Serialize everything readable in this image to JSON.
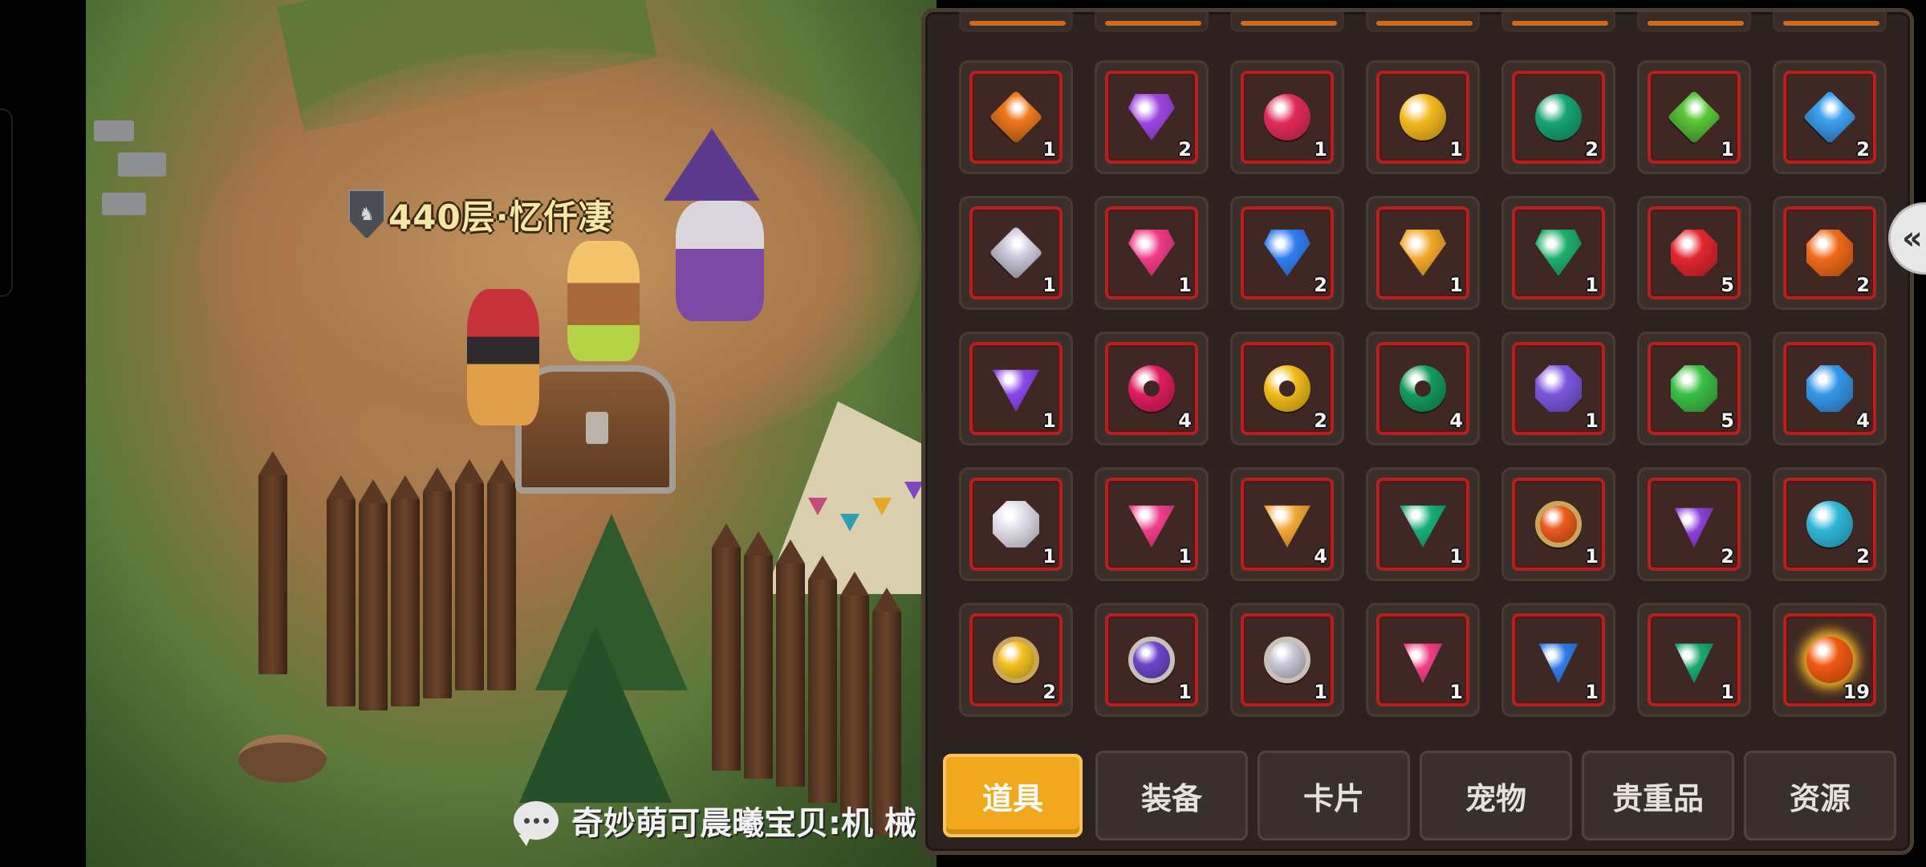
{
  "player": {
    "name": "440层·忆仟凄"
  },
  "chat": {
    "text": "奇妙萌可晨曦宝贝:机 械"
  },
  "collapse_glyph": "«",
  "tabs": [
    {
      "label": "道具",
      "active": true
    },
    {
      "label": "装备",
      "active": false
    },
    {
      "label": "卡片",
      "active": false
    },
    {
      "label": "宠物",
      "active": false
    },
    {
      "label": "贵重品",
      "active": false
    },
    {
      "label": "资源",
      "active": false
    }
  ],
  "inventory_rows": [
    [
      {
        "icon": "orange-diamond-gem-icon",
        "shape": "diamond",
        "color": "#f07a1e",
        "count": "1"
      },
      {
        "icon": "purple-shield-gem-icon",
        "shape": "shield",
        "color": "#9c45e0",
        "count": "2"
      },
      {
        "icon": "crimson-round-gem-icon",
        "shape": "round",
        "color": "#e12b58",
        "count": "1"
      },
      {
        "icon": "yellow-round-gem-icon",
        "shape": "round",
        "color": "#f3b81c",
        "count": "1"
      },
      {
        "icon": "green-round-gem-icon",
        "shape": "round",
        "color": "#17a374",
        "count": "2"
      },
      {
        "icon": "lime-diamond-gem-icon",
        "shape": "diamond",
        "color": "#5cc73a",
        "count": "1"
      },
      {
        "icon": "blue-diamond-gem-icon",
        "shape": "diamond",
        "color": "#3fa2f2",
        "count": "2"
      }
    ],
    [
      {
        "icon": "silver-diamond-gem-icon",
        "shape": "diamond",
        "color": "#cfcde0",
        "count": "1"
      },
      {
        "icon": "pink-shield-gem-icon",
        "shape": "shield",
        "color": "#ef3b86",
        "count": "1"
      },
      {
        "icon": "blue-shield-gem-icon",
        "shape": "shield",
        "color": "#2f7df0",
        "count": "2"
      },
      {
        "icon": "gold-shield-gem-icon",
        "shape": "shield",
        "color": "#f2a72a",
        "count": "1"
      },
      {
        "icon": "green-shield-gem-icon",
        "shape": "shield",
        "color": "#1fae6b",
        "count": "1"
      },
      {
        "icon": "red-octagon-gem-icon",
        "shape": "octa",
        "color": "#e2262e",
        "count": "5"
      },
      {
        "icon": "orange-octagon-gem-icon",
        "shape": "octa",
        "color": "#ef6a19",
        "count": "2"
      }
    ],
    [
      {
        "icon": "violet-triangle-gem-icon",
        "shape": "tri",
        "color": "#8a46e8",
        "count": "1"
      },
      {
        "icon": "magenta-ring-gem-icon",
        "shape": "ring",
        "color": "#e01c5e",
        "count": "4"
      },
      {
        "icon": "gold-ring-gem-icon",
        "shape": "ring",
        "color": "#f1bb18",
        "count": "2"
      },
      {
        "icon": "emerald-ring-gem-icon",
        "shape": "ring",
        "color": "#149a5e",
        "count": "4"
      },
      {
        "icon": "indigo-octagon-gem-icon",
        "shape": "octa",
        "color": "#7b56dd",
        "count": "1"
      },
      {
        "icon": "green-octagon-gem-icon",
        "shape": "octa",
        "color": "#3bbf45",
        "count": "5"
      },
      {
        "icon": "sky-octagon-gem-icon",
        "shape": "octa",
        "color": "#3596ea",
        "count": "4"
      }
    ],
    [
      {
        "icon": "white-octagon-gem-icon",
        "shape": "octa",
        "color": "#e0dde8",
        "count": "1"
      },
      {
        "icon": "rose-triangle-gem-icon",
        "shape": "tri",
        "color": "#ee3f8c",
        "count": "1"
      },
      {
        "icon": "amber-triangle-gem-icon",
        "shape": "tri",
        "color": "#f2a635",
        "count": "4"
      },
      {
        "icon": "teal-triangle-gem-icon",
        "shape": "tri",
        "color": "#18ae79",
        "count": "1"
      },
      {
        "icon": "orange-framed-gem-icon",
        "shape": "framed",
        "color": "#ec5b1c",
        "count": "1"
      },
      {
        "icon": "purple-crowned-gem-icon",
        "shape": "trap",
        "color": "#8a3fd8",
        "count": "2"
      },
      {
        "icon": "cyan-orb-gem-icon",
        "shape": "round",
        "color": "#2fb6d9",
        "count": "2"
      }
    ],
    [
      {
        "icon": "gold-orb-gem-icon",
        "shape": "framed",
        "color": "#f3c21f",
        "count": "2"
      },
      {
        "icon": "purple-framed-gem-icon",
        "shape": "framed-silver",
        "color": "#6a46c9",
        "count": "1"
      },
      {
        "icon": "silver-framed-gem-icon",
        "shape": "framed-silver",
        "color": "#c9c6d6",
        "count": "1"
      },
      {
        "icon": "pink-crowned-gem-icon",
        "shape": "trap",
        "color": "#ef3f86",
        "count": "1"
      },
      {
        "icon": "blue-crowned-gem-icon",
        "shape": "trap",
        "color": "#2f7be6",
        "count": "1"
      },
      {
        "icon": "green-crowned-gem-icon",
        "shape": "trap",
        "color": "#18a670",
        "count": "1"
      },
      {
        "icon": "fire-orb-icon",
        "shape": "sun",
        "color": "#f05a12",
        "count": "19"
      }
    ]
  ]
}
